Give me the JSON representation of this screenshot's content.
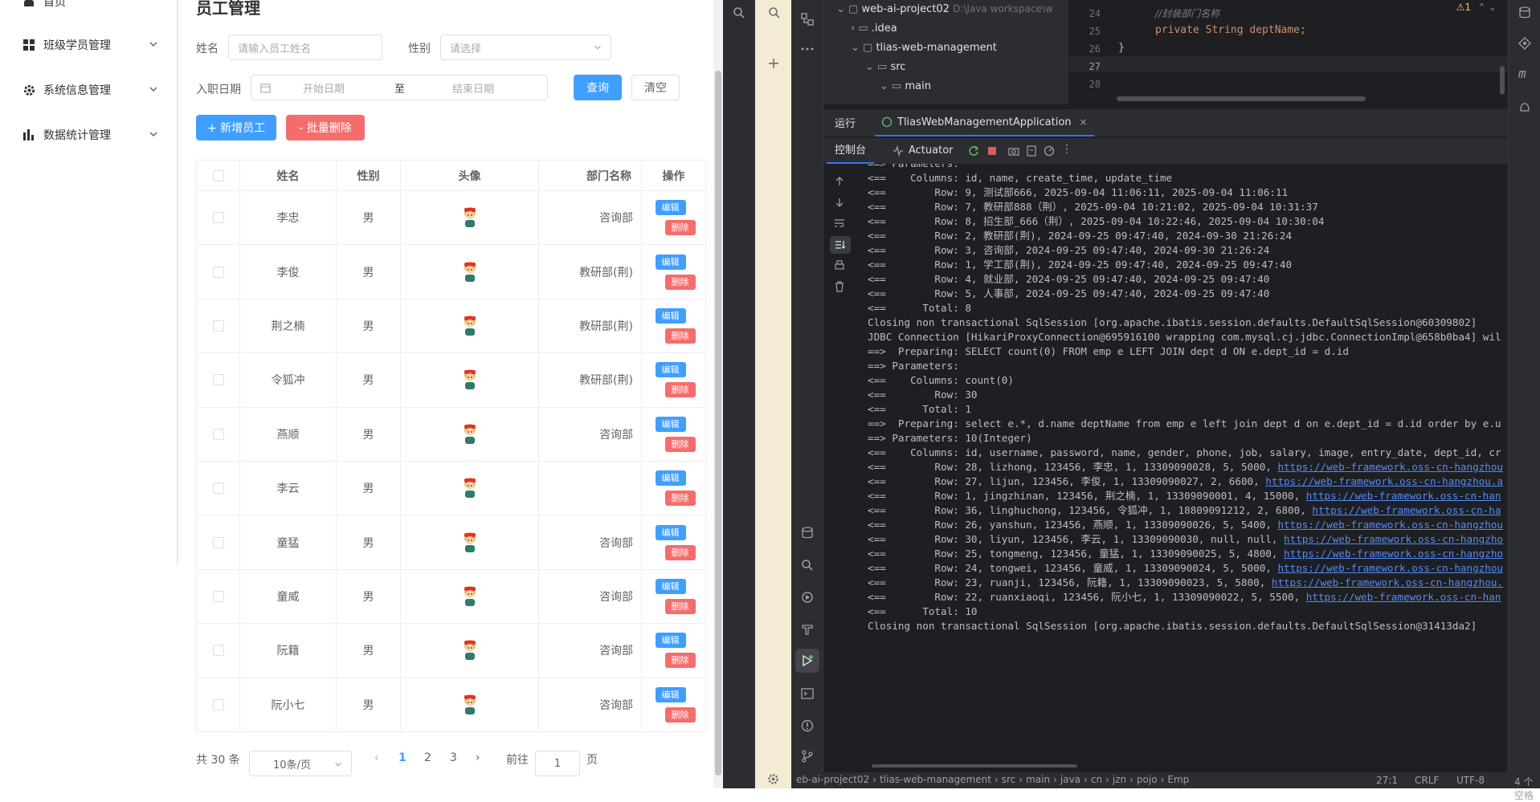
{
  "sidebar": {
    "items": [
      {
        "label": "首页",
        "icon": "home-icon"
      },
      {
        "label": "班级学员管理",
        "icon": "grid-icon"
      },
      {
        "label": "系统信息管理",
        "icon": "gear-icon"
      },
      {
        "label": "数据统计管理",
        "icon": "bar-chart-icon"
      }
    ]
  },
  "page": {
    "title": "员工管理",
    "filters": {
      "name_label": "姓名",
      "name_placeholder": "请输入员工姓名",
      "gender_label": "性别",
      "gender_placeholder": "请选择",
      "date_label": "入职日期",
      "date_start": "开始日期",
      "date_sep": "至",
      "date_end": "结束日期",
      "query_btn": "查询",
      "clear_btn": "清空"
    },
    "actions": {
      "add_btn": "+ 新增员工",
      "batch_delete_btn": "- 批量删除"
    },
    "table": {
      "headers": [
        "姓名",
        "性别",
        "头像",
        "部门名称",
        "操作"
      ],
      "edit_label": "编辑",
      "delete_label": "删除",
      "rows": [
        {
          "name": "李忠",
          "gender": "男",
          "dept": "咨询部"
        },
        {
          "name": "李俊",
          "gender": "男",
          "dept": "教研部(荆)"
        },
        {
          "name": "荆之楠",
          "gender": "男",
          "dept": "教研部(荆)"
        },
        {
          "name": "令狐冲",
          "gender": "男",
          "dept": "教研部(荆)"
        },
        {
          "name": "燕顺",
          "gender": "男",
          "dept": "咨询部"
        },
        {
          "name": "李云",
          "gender": "男",
          "dept": ""
        },
        {
          "name": "童猛",
          "gender": "男",
          "dept": "咨询部"
        },
        {
          "name": "童威",
          "gender": "男",
          "dept": "咨询部"
        },
        {
          "name": "阮籍",
          "gender": "男",
          "dept": "咨询部"
        },
        {
          "name": "阮小七",
          "gender": "男",
          "dept": "咨询部"
        }
      ]
    },
    "pagination": {
      "total": "共 30 条",
      "page_size": "10条/页",
      "pages": [
        "1",
        "2",
        "3"
      ],
      "current": "1",
      "goto_label": "前往",
      "goto_value": "1",
      "goto_suffix": "页"
    }
  },
  "ide": {
    "project_tree": [
      {
        "label": "web-ai-project02",
        "extra": "D:\\Java workspace\\w"
      },
      {
        "label": ".idea"
      },
      {
        "label": "tlias-web-management"
      },
      {
        "label": "src"
      },
      {
        "label": "main"
      }
    ],
    "editor": {
      "lines": [
        {
          "num": "24",
          "text": "//封装部门名称"
        },
        {
          "num": "25",
          "text": "private String deptName;"
        },
        {
          "num": "26",
          "text": "}"
        },
        {
          "num": "27",
          "text": ""
        },
        {
          "num": "28",
          "text": ""
        }
      ],
      "warning_count": "1"
    },
    "run_tab_label": "运行",
    "run_config": "TliasWebManagementApplication",
    "console_tab": "控制台",
    "actuator_tab": "Actuator",
    "console_lines": [
      {
        "text": "==> Parameters:"
      },
      {
        "text": "<==    Columns: id, name, create_time, update_time"
      },
      {
        "text": "<==        Row: 9, 测试部666, 2025-09-04 11:06:11, 2025-09-04 11:06:11"
      },
      {
        "text": "<==        Row: 7, 教研部888（荆）, 2025-09-04 10:21:02, 2025-09-04 10:31:37"
      },
      {
        "text": "<==        Row: 8, 招生部_666（荆）, 2025-09-04 10:22:46, 2025-09-04 10:30:04"
      },
      {
        "text": "<==        Row: 2, 教研部(荆), 2024-09-25 09:47:40, 2024-09-30 21:26:24"
      },
      {
        "text": "<==        Row: 3, 咨询部, 2024-09-25 09:47:40, 2024-09-30 21:26:24"
      },
      {
        "text": "<==        Row: 1, 学工部(荆), 2024-09-25 09:47:40, 2024-09-25 09:47:40"
      },
      {
        "text": "<==        Row: 4, 就业部, 2024-09-25 09:47:40, 2024-09-25 09:47:40"
      },
      {
        "text": "<==        Row: 5, 人事部, 2024-09-25 09:47:40, 2024-09-25 09:47:40"
      },
      {
        "text": "<==      Total: 8"
      },
      {
        "text": "Closing non transactional SqlSession [org.apache.ibatis.session.defaults.DefaultSqlSession@60309802]"
      },
      {
        "text": "JDBC Connection [HikariProxyConnection@695916100 wrapping com.mysql.cj.jdbc.ConnectionImpl@658b0ba4] wil"
      },
      {
        "text": "==>  Preparing: SELECT count(0) FROM emp e LEFT JOIN dept d ON e.dept_id = d.id"
      },
      {
        "text": "==> Parameters:"
      },
      {
        "text": "<==    Columns: count(0)"
      },
      {
        "text": "<==        Row: 30"
      },
      {
        "text": "<==      Total: 1"
      },
      {
        "text": "==>  Preparing: select e.*, d.name deptName from emp e left join dept d on e.dept_id = d.id order by e.u"
      },
      {
        "text": "==> Parameters: 10(Integer)"
      },
      {
        "text": "<==    Columns: id, username, password, name, gender, phone, job, salary, image, entry_date, dept_id, cr"
      },
      {
        "text": "<==        Row: 28, lizhong, 123456, 李忠, 1, 13309090028, 5, 5000, ",
        "url": "https://web-framework.oss-cn-hangzhou"
      },
      {
        "text": "<==        Row: 27, lijun, 123456, 李俊, 1, 13309090027, 2, 6600, ",
        "url": "https://web-framework.oss-cn-hangzhou.a"
      },
      {
        "text": "<==        Row: 1, jingzhinan, 123456, 荆之楠, 1, 13309090001, 4, 15000, ",
        "url": "https://web-framework.oss-cn-han"
      },
      {
        "text": "<==        Row: 36, linghuchong, 123456, 令狐冲, 1, 18809091212, 2, 6800, ",
        "url": "https://web-framework.oss-cn-ha"
      },
      {
        "text": "<==        Row: 26, yanshun, 123456, 燕顺, 1, 13309090026, 5, 5400, ",
        "url": "https://web-framework.oss-cn-hangzhou"
      },
      {
        "text": "<==        Row: 30, liyun, 123456, 李云, 1, 13309090030, null, null, ",
        "url": "https://web-framework.oss-cn-hangzho"
      },
      {
        "text": "<==        Row: 25, tongmeng, 123456, 童猛, 1, 13309090025, 5, 4800, ",
        "url": "https://web-framework.oss-cn-hangzho"
      },
      {
        "text": "<==        Row: 24, tongwei, 123456, 童威, 1, 13309090024, 5, 5000, ",
        "url": "https://web-framework.oss-cn-hangzhou"
      },
      {
        "text": "<==        Row: 23, ruanji, 123456, 阮籍, 1, 13309090023, 5, 5800, ",
        "url": "https://web-framework.oss-cn-hangzhou."
      },
      {
        "text": "<==        Row: 22, ruanxiaoqi, 123456, 阮小七, 1, 13309090022, 5, 5500, ",
        "url": "https://web-framework.oss-cn-han"
      },
      {
        "text": "<==      Total: 10"
      },
      {
        "text": "Closing non transactional SqlSession [org.apache.ibatis.session.defaults.DefaultSqlSession@31413da2]"
      }
    ],
    "statusbar": {
      "breadcrumb": [
        "eb-ai-project02",
        "tlias-web-management",
        "src",
        "main",
        "java",
        "cn",
        "jzn",
        "pojo",
        "Emp"
      ],
      "position": "27:1",
      "line_sep": "CRLF",
      "encoding": "UTF-8",
      "indent": "4 个空格"
    }
  }
}
